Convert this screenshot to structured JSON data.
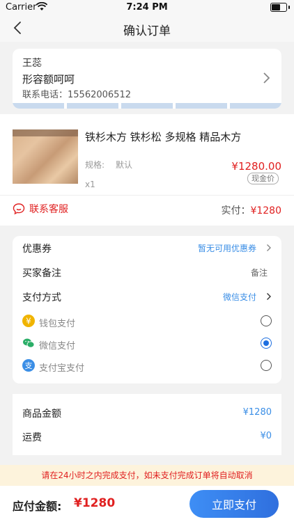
{
  "status_bar": {
    "carrier": "Carrier",
    "time": "7:24 PM"
  },
  "nav": {
    "title": "确认订单"
  },
  "address": {
    "name": "王蕊",
    "detail": "形容额呵呵",
    "phone": "联系电话：15562006512"
  },
  "goods": {
    "title": "铁杉木方 铁杉松 多规格 精品木方",
    "spec_label": "规格:",
    "spec_value": "默认",
    "quantity": "x1",
    "price": "¥1280.00",
    "price_badge": "现金价",
    "service_label": "联系客服",
    "paid_label": "实付：",
    "paid_value": "¥1280"
  },
  "options": {
    "coupon_label": "优惠券",
    "coupon_value": "暂无可用优惠券",
    "remark_label": "买家备注",
    "remark_value": "备注",
    "payment_label": "支付方式",
    "payment_value": "微信支付",
    "methods": [
      {
        "label": "钱包支付",
        "icon": "wallet-icon",
        "color": "#f0b400",
        "selected": false
      },
      {
        "label": "微信支付",
        "icon": "wechat-icon",
        "color": "#2aae67",
        "selected": true
      },
      {
        "label": "支付宝支付",
        "icon": "alipay-icon",
        "color": "#3a8ee6",
        "selected": false
      }
    ]
  },
  "summary": {
    "goods_amount_label": "商品金额",
    "goods_amount_value": "¥1280",
    "shipping_label": "运费",
    "shipping_value": "¥0"
  },
  "notice": "请在24小时之内完成支付，如未支付完成订单将自动取消",
  "footer": {
    "total_label": "应付金额:",
    "total_value": "¥1280",
    "pay_button": "立即支付"
  },
  "colors": {
    "accent": "#2f6fde",
    "price": "#e02020",
    "notice_bg": "#fdf3dc"
  }
}
